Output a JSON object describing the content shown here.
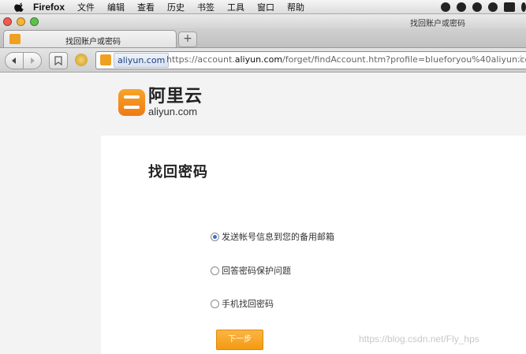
{
  "menubar": {
    "app_name": "Firefox",
    "items": [
      "文件",
      "编辑",
      "查看",
      "历史",
      "书签",
      "工具",
      "窗口",
      "帮助"
    ]
  },
  "window": {
    "title": "找回账户或密码"
  },
  "tab": {
    "title": "找回账户或密码",
    "new_tab_label": "+"
  },
  "navbar": {
    "identity_label": "aliyun.com",
    "url_prefix": "https://account.",
    "url_domain": "aliyun.com",
    "url_rest": "/forget/findAccount.htm?profile=blueforyou%40aliyun.co",
    "star": "☆"
  },
  "page": {
    "logo_cn": "阿里云",
    "logo_en": "aliyun.com",
    "title": "找回密码",
    "options": [
      {
        "label": "发送帐号信息到您的备用邮箱",
        "checked": true
      },
      {
        "label": "回答密码保护问题",
        "checked": false
      },
      {
        "label": "手机找回密码",
        "checked": false
      }
    ],
    "next_button": "下一步",
    "watermark": "https://blog.csdn.net/Fly_hps"
  },
  "colors": {
    "accent": "#f39a12",
    "brand": "#ef7a14"
  }
}
